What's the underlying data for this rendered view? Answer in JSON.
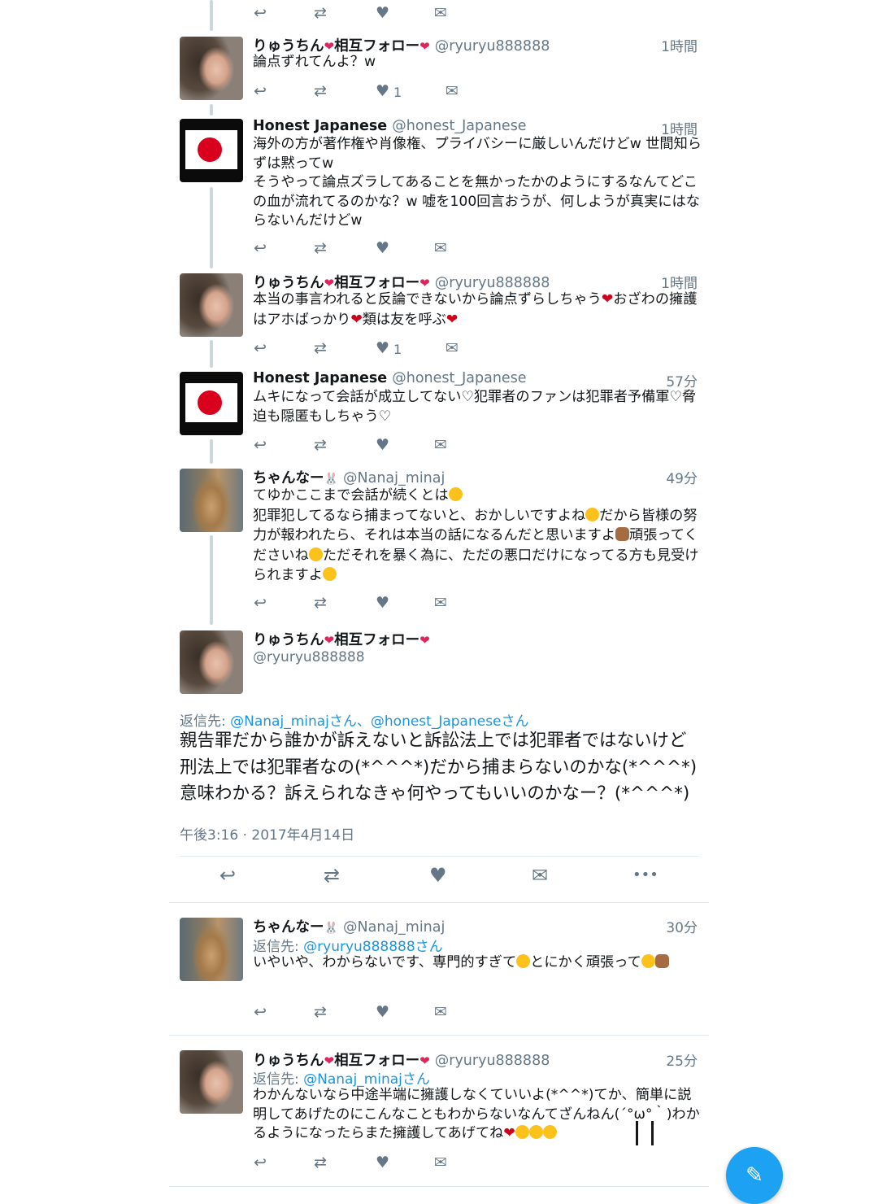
{
  "icons": {
    "reply": "↩",
    "retweet": "⇄",
    "like": "♥",
    "dm": "✉",
    "more": "•••",
    "compose": "✎"
  },
  "colors": {
    "accent": "#1b95e0",
    "heart": "#e0245e",
    "secondary": "#657786",
    "fab": "#1da1f2"
  },
  "tweets": [
    {
      "name": "りゅうちん",
      "name_suffix": "相互フォロー",
      "handle": "@ryuryu888888",
      "time": "1時間",
      "text": "論点ずれてんよ？w",
      "like_count": "1"
    },
    {
      "name": "Honest Japanese",
      "handle": "@honest_Japanese",
      "time": "1時間",
      "text": "海外の方が著作権や肖像権、プライバシーに厳しいんだけどw 世間知らずは黙ってw\nそうやって論点ズラしてあることを無かったかのようにするなんてどこの血が流れてるのかな？w 嘘を100回言おうが、何しようが真実にはならないんだけどw"
    },
    {
      "name": "りゅうちん",
      "name_suffix": "相互フォロー",
      "handle": "@ryuryu888888",
      "time": "1時間",
      "text_a": "本当の事言われると反論できないから論点ずらしちゃう",
      "text_b": "おざわの擁護はアホばっかり",
      "text_c": "類は友を呼ぶ",
      "like_count": "1"
    },
    {
      "name": "Honest Japanese",
      "handle": "@honest_Japanese",
      "time": "57分",
      "text": "ムキになって会話が成立してない♡犯罪者のファンは犯罪者予備軍♡脅迫も隠匿もしちゃう♡"
    },
    {
      "name": "ちゃんなー",
      "name_suffix": "🐰",
      "handle": "@Nanaj_minaj",
      "time": "49分",
      "line1": "てゆかここまで会話が続くとは",
      "line2a": "犯罪犯してるなら捕まってないと、おかしいですよね",
      "line2b": "だから皆様の努力が報われたら、それは本当の話になるんだと思いますよ",
      "line2c": "頑張ってくださいね",
      "line2d": "ただそれを暴く為に、ただの悪口だけになってる方も見受けられますよ"
    }
  ],
  "focused": {
    "name": "りゅうちん",
    "name_suffix": "相互フォロー",
    "handle": "@ryuryu888888",
    "reply_label": "返信先:",
    "reply_targets": "@Nanaj_minajさん、@honest_Japaneseさん",
    "text": "親告罪だから誰かが訴えないと訴訟法上では犯罪者ではないけど刑法上では犯罪者なの(*^^^*)だから捕まらないのかな(*^^^*)意味わかる？訴えられなきゃ何やってもいいのかなー？(*^^^*)",
    "timestamp": "午後3:16 · 2017年4月14日"
  },
  "replies": [
    {
      "name": "ちゃんなー",
      "name_suffix": "🐰",
      "handle": "@Nanaj_minaj",
      "time": "30分",
      "reply_label": "返信先:",
      "reply_target": "@ryuryu888888さん",
      "text_a": "いやいや、わからないです、専門的すぎて",
      "text_b": "とにかく頑張って"
    },
    {
      "name": "りゅうちん",
      "name_suffix": "相互フォロー",
      "handle": "@ryuryu888888",
      "time": "25分",
      "reply_label": "返信先:",
      "reply_target": "@Nanaj_minajさん",
      "text": "わかんないなら中途半端に擁護しなくていいよ(*^^*)てか、簡単に説明してあげたのにこんなこともわからないなんてざんねん(´°ω°｀)わかるようになったらまた擁護してあげてね"
    }
  ]
}
